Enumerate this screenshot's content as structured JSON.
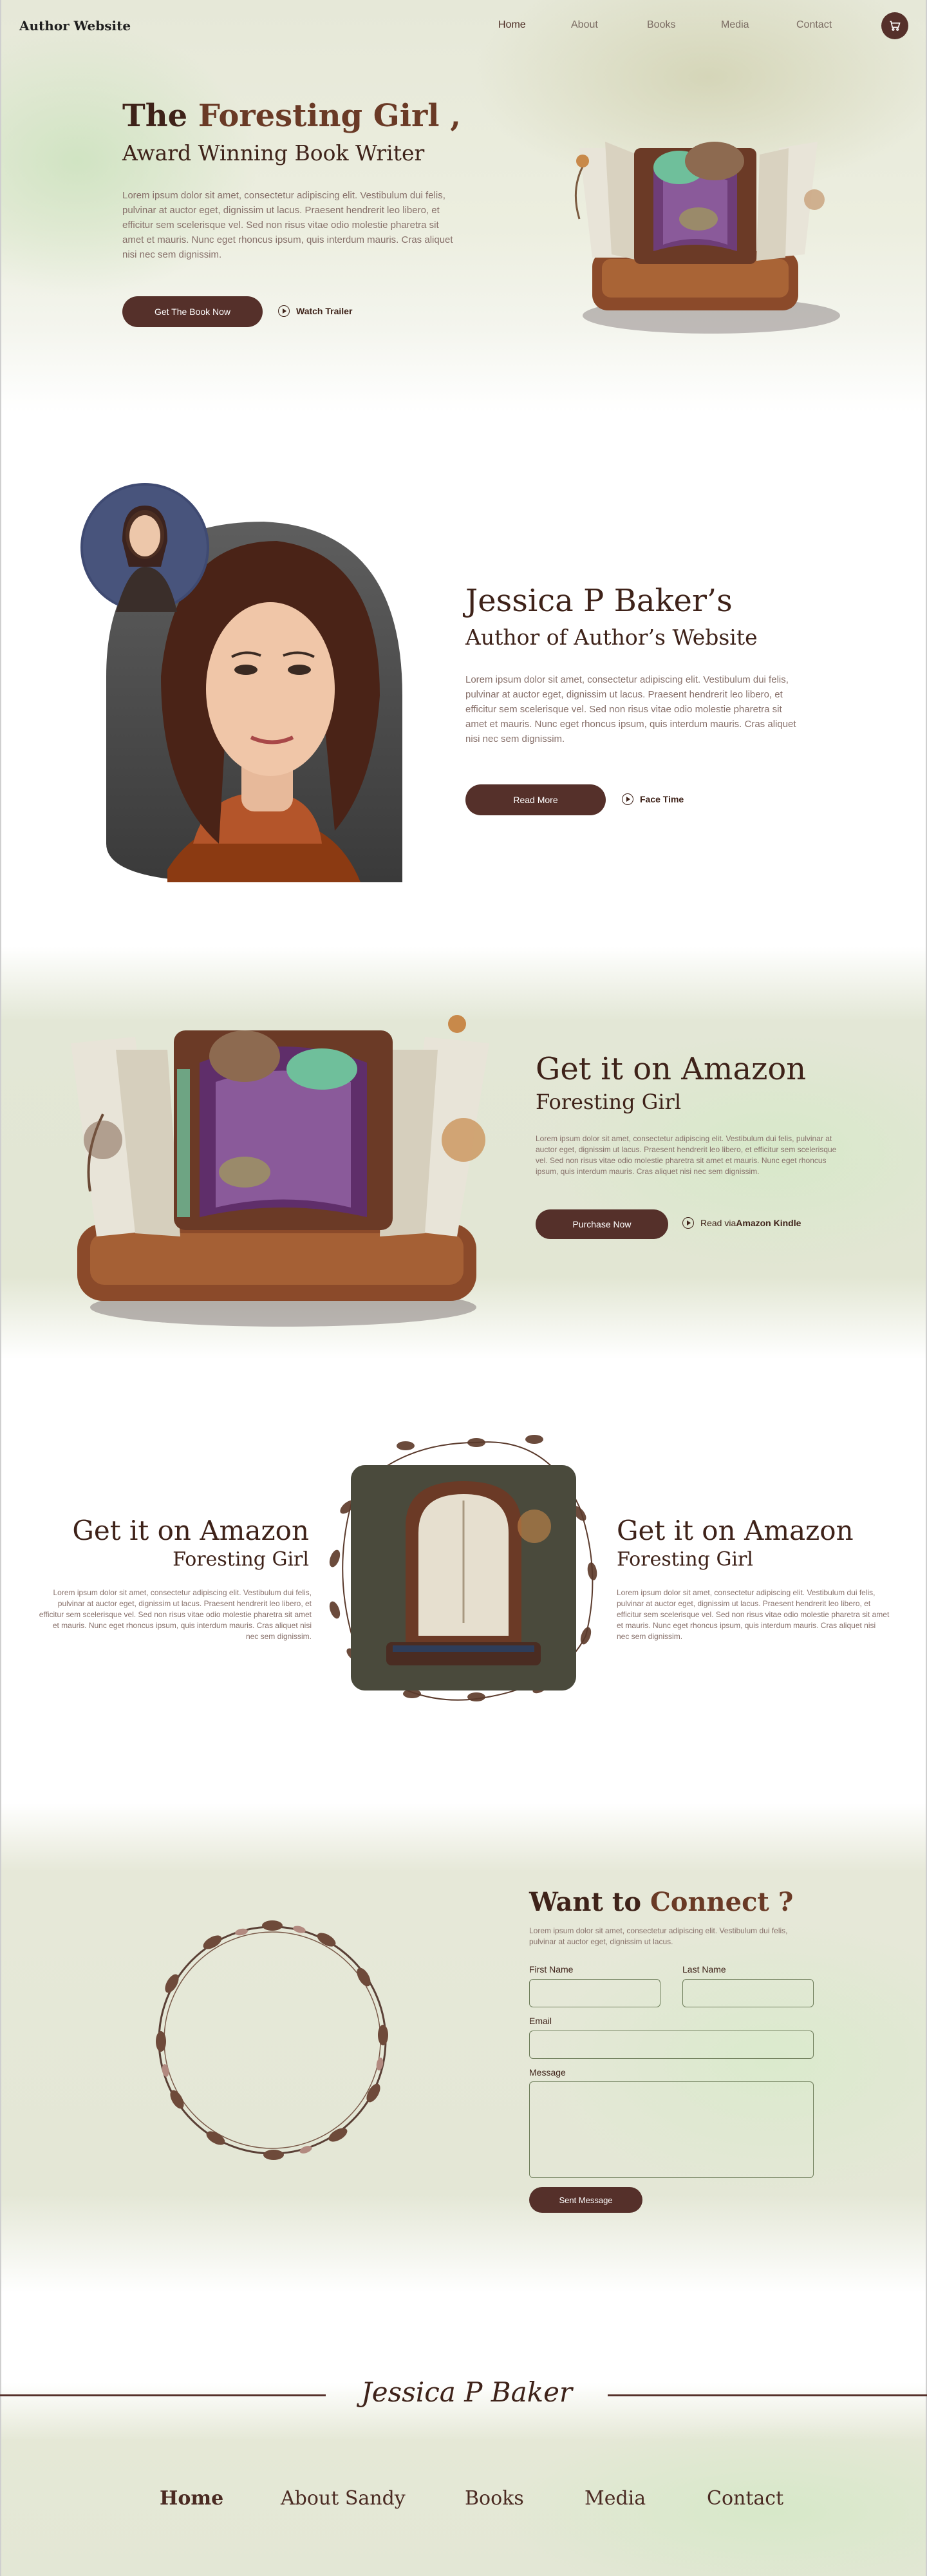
{
  "brand": "Author Website",
  "nav": {
    "items": [
      "Home",
      "About",
      "Books",
      "Media",
      "Contact"
    ],
    "cart_icon": "cart-icon"
  },
  "hero": {
    "title_prefix": "The ",
    "title_accent": "Foresting Girl ,",
    "subtitle": "Award Winning Book Writer",
    "body": "Lorem ipsum dolor sit amet, consectetur adipiscing elit. Vestibulum dui felis, pulvinar at auctor eget, dignissim ut lacus. Praesent hendrerit leo libero, et efficitur sem scelerisque vel. Sed non risus vitae odio molestie pharetra sit amet et mauris. Nunc eget rhoncus ipsum, quis interdum mauris. Cras aliquet nisi nec sem dignissim.",
    "cta": "Get The Book Now",
    "secondary": "Watch Trailer"
  },
  "about": {
    "title": "Jessica P Baker’s",
    "subtitle": "Author of Author’s Website",
    "body": "Lorem ipsum dolor sit amet, consectetur adipiscing elit. Vestibulum dui felis, pulvinar at auctor eget, dignissim ut lacus. Praesent hendrerit leo libero, et efficitur sem scelerisque vel. Sed non risus vitae odio molestie pharetra sit amet et mauris. Nunc eget rhoncus ipsum, quis interdum mauris. Cras aliquet nisi nec sem dignissim.",
    "cta": "Read More",
    "secondary": "Face Time"
  },
  "amazon": {
    "title": "Get it on Amazon",
    "subtitle": "Foresting Girl",
    "body": "Lorem ipsum dolor sit amet, consectetur adipiscing elit. Vestibulum dui felis, pulvinar at auctor eget, dignissim ut lacus. Praesent hendrerit leo libero, et efficitur sem scelerisque vel. Sed non risus vitae odio molestie pharetra sit amet et mauris. Nunc eget rhoncus ipsum, quis interdum mauris. Cras aliquet nisi nec sem dignissim.",
    "cta": "Purchase Now",
    "secondary_prefix": "Read via ",
    "secondary_bold": "Amazon Kindle"
  },
  "feature": {
    "left": {
      "title": "Get it on Amazon",
      "subtitle": "Foresting Girl",
      "body": "Lorem ipsum dolor sit amet, consectetur adipiscing elit. Vestibulum dui felis, pulvinar at auctor eget, dignissim ut lacus. Praesent hendrerit leo libero, et efficitur sem scelerisque vel. Sed non risus vitae odio molestie pharetra sit amet et mauris. Nunc eget rhoncus ipsum, quis interdum mauris. Cras aliquet nisi nec sem dignissim."
    },
    "right": {
      "title": "Get it on Amazon",
      "subtitle": "Foresting Girl",
      "body": "Lorem ipsum dolor sit amet, consectetur adipiscing elit. Vestibulum dui felis, pulvinar at auctor eget, dignissim ut lacus. Praesent hendrerit leo libero, et efficitur sem scelerisque vel. Sed non risus vitae odio molestie pharetra sit amet et mauris. Nunc eget rhoncus ipsum, quis interdum mauris. Cras aliquet nisi nec sem dignissim."
    }
  },
  "connect": {
    "title_prefix": "Want to ",
    "title_accent": "Connect ?",
    "body": "Lorem ipsum dolor sit amet, consectetur adipiscing elit. Vestibulum dui felis, pulvinar at auctor eget, dignissim ut lacus.",
    "first_name_label": "First Name",
    "last_name_label": "Last Name",
    "email_label": "Email",
    "message_label": "Message",
    "submit": "Sent Message"
  },
  "footer": {
    "signature": "Jessica P Baker",
    "nav": [
      "Home",
      "About Sandy",
      "Books",
      "Media",
      "Contact"
    ]
  },
  "colors": {
    "accent": "#55302a",
    "title_dark": "#3e2219",
    "body_text": "#87706a",
    "field_border": "#6e7d5a"
  }
}
